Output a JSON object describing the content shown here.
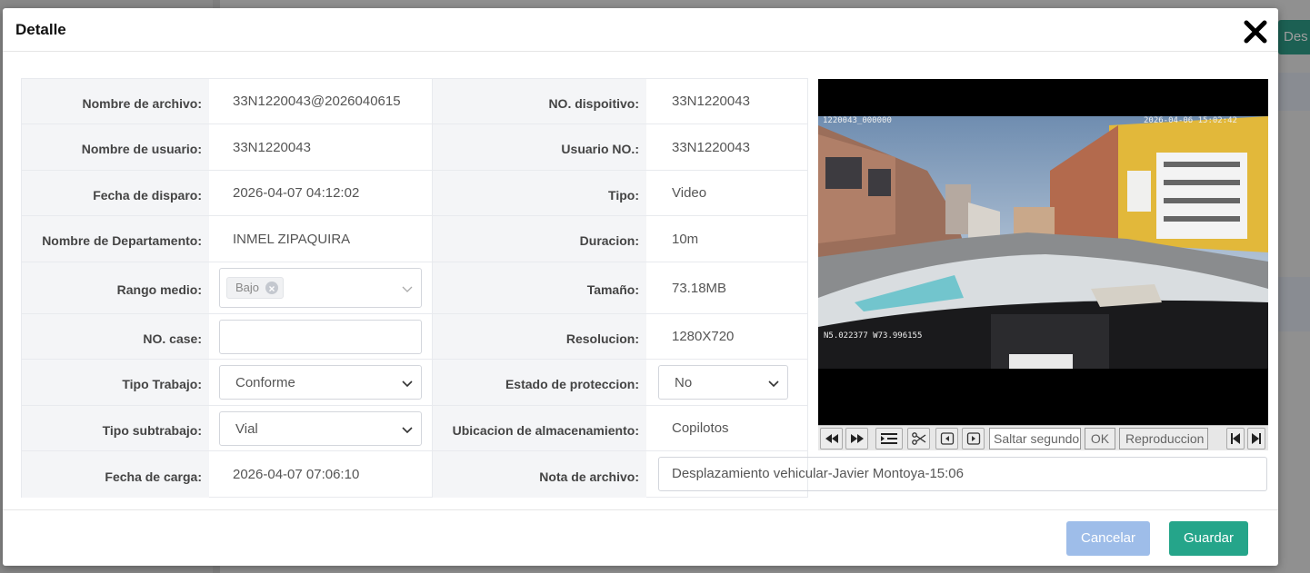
{
  "background": {
    "button_label": "Des"
  },
  "modal": {
    "title": "Detalle"
  },
  "form": {
    "rows": [
      {
        "label1": "Nombre de archivo:",
        "value1": "33N1220043@2026040615",
        "label2": "NO. dispoitivo:",
        "value2": "33N1220043"
      },
      {
        "label1": "Nombre de usuario:",
        "value1": "33N1220043",
        "label2": "Usuario NO.:",
        "value2": "33N1220043"
      },
      {
        "label1": "Fecha de disparo:",
        "value1": "2026-04-07 04:12:02",
        "label2": "Tipo:",
        "value2": "Video"
      },
      {
        "label1": "Nombre de Departamento:",
        "value1": "INMEL ZIPAQUIRA",
        "label2": "Duracion:",
        "value2": "10m"
      },
      {
        "label1": "Rango medio:",
        "label2": "Tamaño:",
        "value2": "73.18MB"
      },
      {
        "label1": "NO. case:",
        "label2": "Resolucion:",
        "value2": "1280X720"
      },
      {
        "label1": "Tipo Trabajo:",
        "label2": "Estado de proteccion:"
      },
      {
        "label1": "Tipo subtrabajo:",
        "label2": "Ubicacion de almacenamiento:",
        "value2": "Copilotos"
      },
      {
        "label1": "Fecha de carga:",
        "value1": "2026-04-07 07:06:10",
        "label2": "Nota de archivo:"
      }
    ],
    "rango_medio_tag": "Bajo",
    "no_case_value": "",
    "tipo_trabajo_selected": "Conforme",
    "tipo_subtrabajo_selected": "Vial",
    "estado_proteccion_selected": "No",
    "nota_archivo_value": "Desplazamiento vehicular-Javier Montoya-15:06"
  },
  "video": {
    "osd_channel": "1220043_000000",
    "osd_timestamp": "2026-04-06 15:02:42",
    "osd_gps": "N5.022377  W73.996155",
    "seek_placeholder": "Saltar segundo",
    "ok_label": "OK",
    "playback_label": "Reproduccion"
  },
  "footer": {
    "cancel_label": "Cancelar",
    "save_label": "Guardar"
  },
  "colors": {
    "save": "#25a58a",
    "cancel": "#9ebde9",
    "label_bg": "#f4f5f7"
  }
}
